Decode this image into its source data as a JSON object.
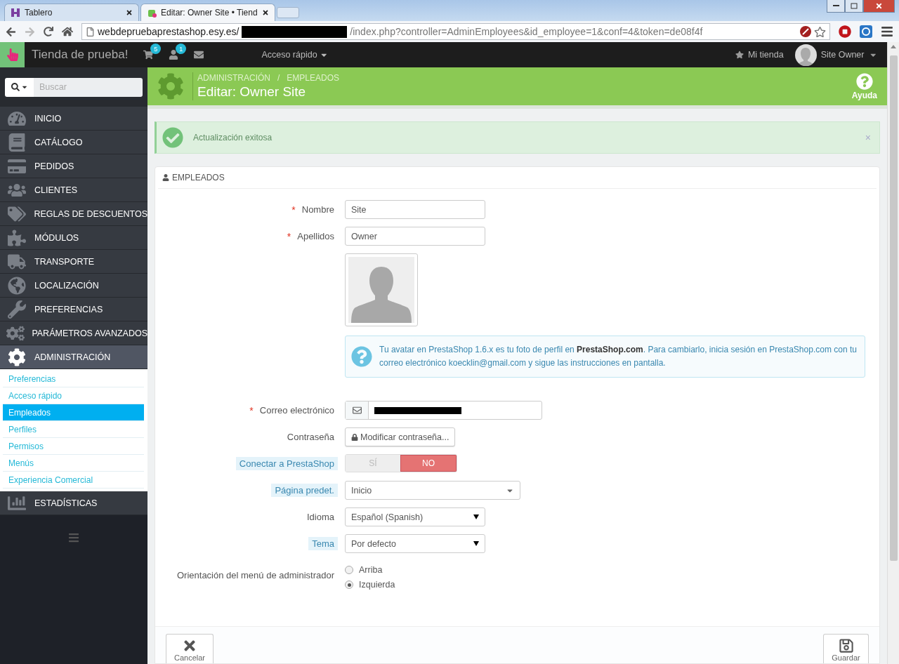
{
  "browser": {
    "tabs": [
      {
        "title": "Tablero",
        "selected": false
      },
      {
        "title": "Editar: Owner Site • Tiend",
        "selected": true
      }
    ],
    "url_start": "webdepruebaprestashop.esy.es/",
    "url_redacted": true,
    "url_end": "/index.php?controller=AdminEmployees&id_employee=1&conf=4&token=de08f4f"
  },
  "topbar": {
    "shop_name": "Tienda de prueba!",
    "cart_count": "5",
    "customer_count": "1",
    "quick_access": "Acceso rápido",
    "my_shop": "Mi tienda",
    "user": "Site Owner"
  },
  "sidebar": {
    "search_placeholder": "Buscar",
    "items": [
      {
        "label": "INICIO",
        "selected": false
      },
      {
        "label": "CATÁLOGO",
        "selected": false
      },
      {
        "label": "PEDIDOS",
        "selected": false
      },
      {
        "label": "CLIENTES",
        "selected": false
      },
      {
        "label": "REGLAS DE DESCUENTOS",
        "selected": false
      },
      {
        "label": "MÓDULOS",
        "selected": false
      },
      {
        "label": "TRANSPORTE",
        "selected": false
      },
      {
        "label": "LOCALIZACIÓN",
        "selected": false
      },
      {
        "label": "PREFERENCIAS",
        "selected": false
      },
      {
        "label": "PARÁMETROS AVANZADOS",
        "selected": false
      },
      {
        "label": "ADMINISTRACIÓN",
        "selected": true,
        "children": [
          {
            "label": "Preferencias",
            "selected": false
          },
          {
            "label": "Acceso rápido",
            "selected": false
          },
          {
            "label": "Empleados",
            "selected": true
          },
          {
            "label": "Perfiles",
            "selected": false
          },
          {
            "label": "Permisos",
            "selected": false
          },
          {
            "label": "Menús",
            "selected": false
          },
          {
            "label": "Experiencia Comercial",
            "selected": false
          }
        ]
      },
      {
        "label": "ESTADÍSTICAS",
        "selected": false
      }
    ]
  },
  "header": {
    "breadcrumb": [
      "ADMINISTRACIÓN",
      "EMPLEADOS"
    ],
    "separator": "/",
    "title": "Editar: Owner Site",
    "help": "Ayuda"
  },
  "alert": {
    "text": "Actualización exitosa",
    "close": "×"
  },
  "panel": {
    "title": "EMPLEADOS",
    "fields": [
      {
        "kind": "text",
        "label": "Nombre",
        "mark": "*",
        "value": "Site"
      },
      {
        "kind": "text",
        "label": "Apellidos",
        "mark": "*",
        "value": "Owner"
      },
      {
        "kind": "avatar"
      },
      {
        "kind": "info",
        "text": "Tu avatar en PrestaShop 1.6.x es tu foto de perfil en **PrestaShop.com**. Para cambiarlo, inicia sesión en PrestaShop.com con tu correo electrónico koecklin@gmail.com y sigue las instrucciones en pantalla."
      },
      {
        "kind": "email",
        "label": "Correo electrónico",
        "mark": "*",
        "redacted": true
      },
      {
        "kind": "button",
        "label": "Contraseña",
        "button": "Modificar contraseña..."
      },
      {
        "kind": "switch",
        "label": "Conectar a PrestaShop",
        "hint": true,
        "options": [
          {
            "label": "SÍ",
            "selected": false
          },
          {
            "label": "NO",
            "selected": true
          }
        ]
      },
      {
        "kind": "combo",
        "label": "Página predet.",
        "hint": true,
        "value": "Inicio"
      },
      {
        "kind": "select",
        "label": "Idioma",
        "value": "Español (Spanish)"
      },
      {
        "kind": "select",
        "label": "Tema",
        "hint": true,
        "value": "Por defecto"
      },
      {
        "kind": "radio",
        "label": "Orientación del menú de administrador",
        "options": [
          {
            "label": "Arriba",
            "selected": false
          },
          {
            "label": "Izquierda",
            "selected": true
          }
        ]
      }
    ],
    "cancel": "Cancelar",
    "save": "Guardar"
  }
}
